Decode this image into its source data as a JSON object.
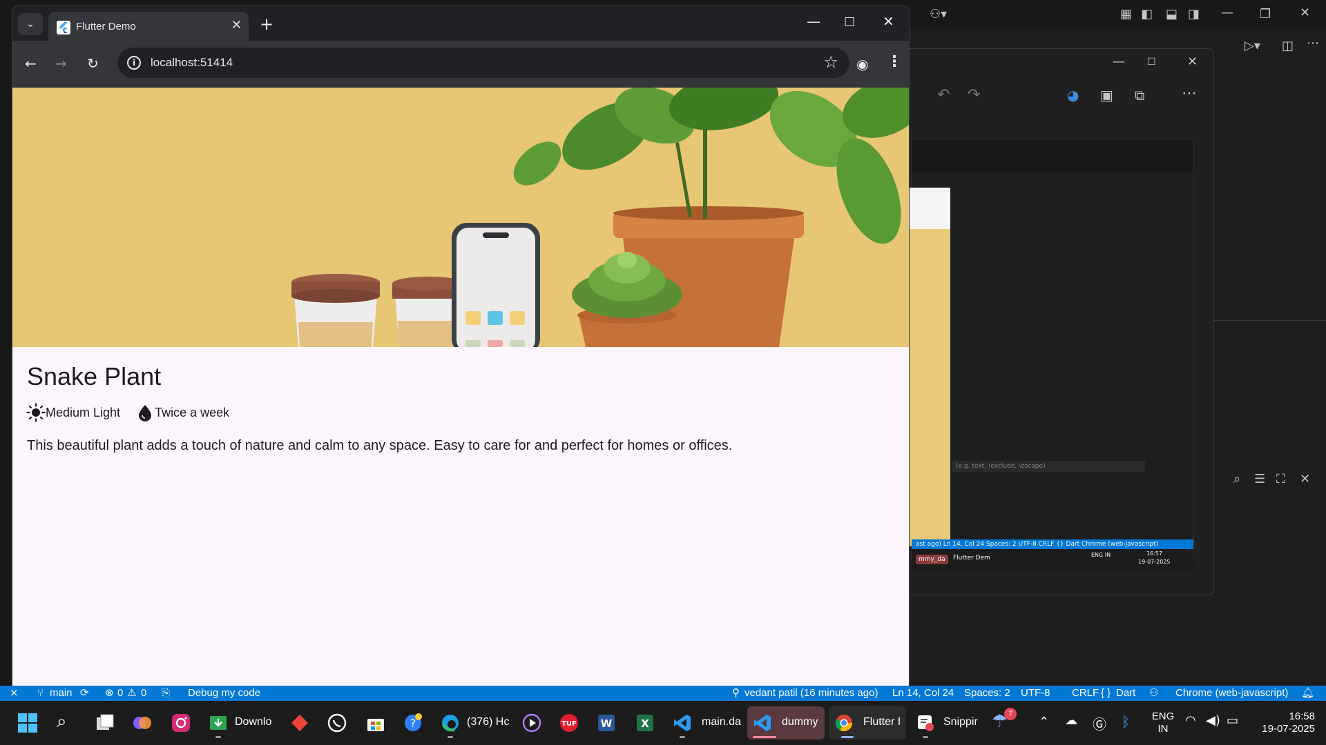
{
  "browser": {
    "tab_title": "Flutter Demo",
    "url": "localhost:51414"
  },
  "plant": {
    "name": "Snake Plant",
    "light": "Medium Light",
    "water": "Twice a week",
    "description": "This beautiful plant adds a touch of nature and calm to any space. Easy to care for and perfect for homes or offices."
  },
  "statusbar": {
    "branch": "main",
    "problems": "0",
    "warnings": "0",
    "debug": "Debug my code",
    "author": "vedant patil (16 minutes ago)",
    "position": "Ln 14, Col 24",
    "spaces": "Spaces: 2",
    "encoding": "UTF-8",
    "eol": "CRLF",
    "language": "Dart",
    "device": "Chrome (web-javascript)"
  },
  "snip": {
    "status_text": "ast ago)   Ln 14, Col 24   Spaces: 2   UTF-8   CRLF   {} Dart   Chrome (web-javascript)",
    "search_placeholder": "(e.g. text, !exclude, \\escape)",
    "task_label1": "mmy_da",
    "task_label2": "Flutter Dem",
    "task_lang": "ENG IN",
    "task_time": "16:57",
    "task_date": "19-07-2025"
  },
  "taskbar": {
    "apps": [
      {
        "name": "Downlo"
      },
      {
        "name": "(376) Hc"
      },
      {
        "name": "main.da"
      },
      {
        "name": "dummy"
      },
      {
        "name": "Flutter I"
      },
      {
        "name": "Snippir"
      }
    ],
    "weather_badge": "7",
    "lang_top": "ENG",
    "lang_bottom": "IN",
    "time": "16:58",
    "date": "19-07-2025"
  },
  "colors": {
    "statusbar": "#0078d4",
    "hero_bg": "#e7c674",
    "page_bg": "#fdf6fc",
    "chrome_frame": "#202124",
    "chrome_toolbar": "#35363a"
  }
}
